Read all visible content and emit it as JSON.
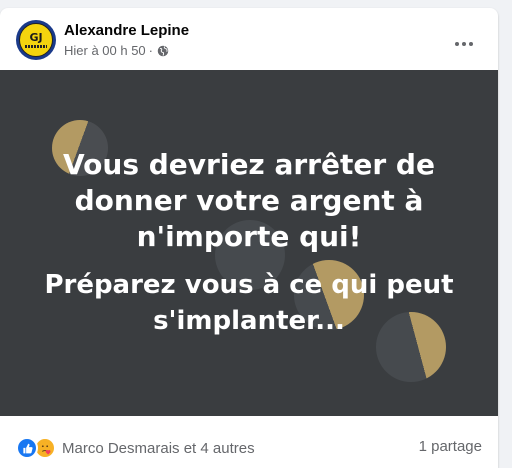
{
  "post": {
    "author": "Alexandre Lepine",
    "timestamp": "Hier à 00 h 50",
    "separator": "·",
    "audience_icon": "globe-icon",
    "avatar_text": "GJ",
    "more_icon": "more-options-icon",
    "text_line1": "Vous devriez arrêter de donner votre argent à n'importe qui!",
    "text_line2": "Préparez vous à ce qui peut s'implanter...",
    "background_color": "#3a3d40",
    "moon_color": "#b39a63"
  },
  "footer": {
    "reaction_icons": [
      "like-icon",
      "care-icon"
    ],
    "reactions_text": "Marco Desmarais et 4 autres",
    "shares_text": "1 partage"
  },
  "colors": {
    "like_blue": "#1877f2",
    "care_yellow": "#f7b125",
    "secondary_text": "#65676b"
  }
}
